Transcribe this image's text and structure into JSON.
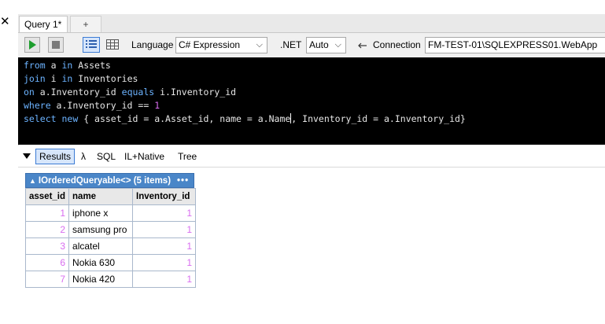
{
  "window": {
    "close_glyph": "✕"
  },
  "tabs": [
    {
      "label": "Query 1*"
    },
    {
      "label": "+"
    }
  ],
  "toolbar": {
    "language_label": "Language",
    "language_value": "C# Expression",
    "net_label": ".NET",
    "net_value": "Auto",
    "connection_label": "Connection",
    "connection_value": "FM-TEST-01\\SQLEXPRESS01.WebApp",
    "icons": [
      "run-icon",
      "stop-icon",
      "rich-text-view-icon",
      "grid-view-icon",
      "connection-plug-icon"
    ]
  },
  "editor": {
    "lines": [
      [
        {
          "t": "from",
          "c": "kw"
        },
        {
          "t": " a "
        },
        {
          "t": "in",
          "c": "kw"
        },
        {
          "t": " Assets"
        }
      ],
      [
        {
          "t": "join",
          "c": "kw"
        },
        {
          "t": " i "
        },
        {
          "t": "in",
          "c": "kw"
        },
        {
          "t": " Inventories"
        }
      ],
      [
        {
          "t": "on",
          "c": "kw"
        },
        {
          "t": " a.Inventory_id "
        },
        {
          "t": "equals",
          "c": "kw"
        },
        {
          "t": " i.Inventory_id"
        }
      ],
      [
        {
          "t": "where",
          "c": "kw"
        },
        {
          "t": " a.Inventory_id == "
        },
        {
          "t": "1",
          "c": "num"
        }
      ],
      [
        {
          "t": "select",
          "c": "kw"
        },
        {
          "t": " "
        },
        {
          "t": "new",
          "c": "kw"
        },
        {
          "t": " { asset_id = a.Asset_id, name = a.Name"
        },
        {
          "caret": true
        },
        {
          "t": ", Inventory_id = a.Inventory_id}"
        }
      ]
    ],
    "colors": {
      "background": "#000000",
      "keyword": "#6cb3ff",
      "number": "#d86cf0",
      "text": "#e6e6e6"
    }
  },
  "results_tabs": [
    {
      "label": "Results"
    },
    {
      "label": "λ"
    },
    {
      "label": "SQL"
    },
    {
      "label": "IL+Native"
    },
    {
      "label": "Tree"
    }
  ],
  "result": {
    "header_caret": "▲",
    "header": "IOrderedQueryable<> (5 items)",
    "header_more": "•••",
    "columns": [
      "asset_id",
      "name",
      "Inventory_id"
    ],
    "rows": [
      [
        "1",
        "iphone x",
        "1"
      ],
      [
        "2",
        "samsung pro",
        "1"
      ],
      [
        "3",
        "alcatel",
        "1"
      ],
      [
        "6",
        "Nokia 630",
        "1"
      ],
      [
        "7",
        "Nokia 420",
        "1"
      ]
    ],
    "accent_color": "#4a86c8"
  }
}
